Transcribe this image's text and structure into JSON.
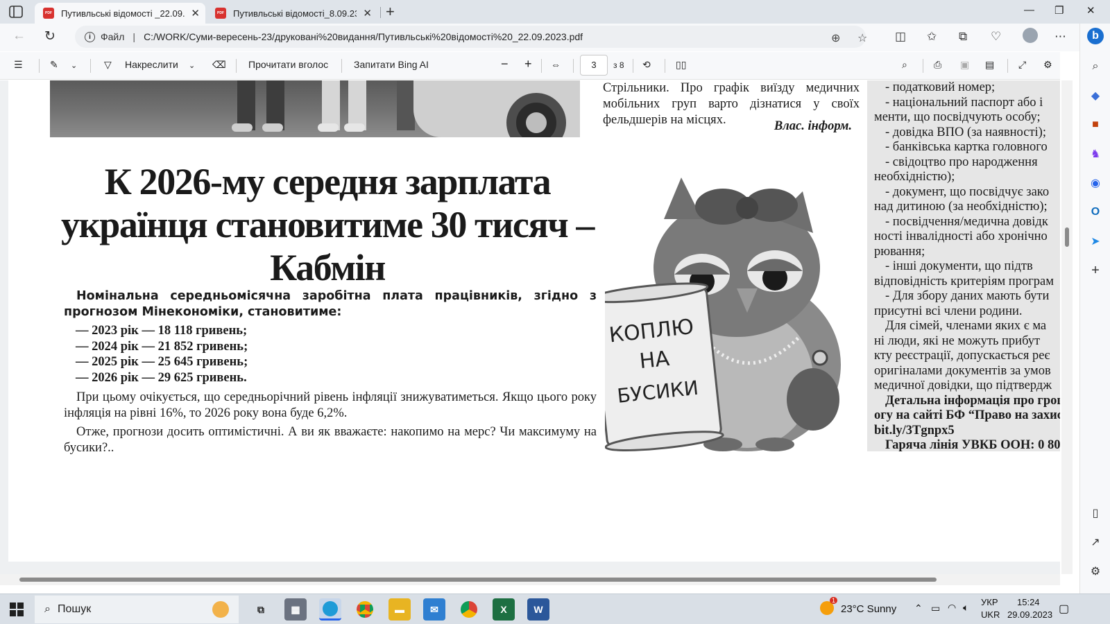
{
  "browser": {
    "tabs": [
      {
        "label": "Путивльські відомості _22.09.2023.pdf",
        "active": true
      },
      {
        "label": "Путивльські відомості_8.09.23.pdf",
        "active": false
      }
    ],
    "address": {
      "scheme_label": "Файл",
      "url": "C:/WORK/Суми-вересень-23/друковані%20видання/Путивльські%20відомості%20_22.09.2023.pdf"
    }
  },
  "pdf_toolbar": {
    "draw_label": "Накреслити",
    "read_aloud_label": "Прочитати вголос",
    "ask_bing_label": "Запитати Bing AI",
    "page_current": "3",
    "page_total": "з 8"
  },
  "article": {
    "headline": "К 2026-му середня зарплата українця становитиме 30 тисяч – Кабмін",
    "lead": "Номінальна середньомісячна заробітна плата працівників, згідно з прогнозом Мінекономіки, становитиме:",
    "forecast": [
      "2023 рік — 18 118 гривень;",
      "2024 рік — 21 852 гривень;",
      "2025 рік — 25 645 гривень;",
      "2026 рік — 29 625 гривень."
    ],
    "paragraph1": "При цьому очікується, що середньорічний рівень інфляції знижуватиметься. Якщо цього року інфляція на рівні 16%, то 2026 року вона буде 6,2%.",
    "paragraph2": "Отже, прогнози досить оптимістичні. А ви як вважаєте: накопимо на мерс? Чи максимуму на бусики?.."
  },
  "middle_column": {
    "top_fragment": "Стрільники. Про графік виїзду медичних мобільних груп варто дізнатися у своїх фельдшерів на місцях.",
    "byline": "Влас. інформ.",
    "owl_sign": [
      "КОПЛЮ",
      "НА",
      "БУСИКИ"
    ]
  },
  "right_column": {
    "lines": [
      {
        "text": "- податковий номер;",
        "ind": true,
        "bold": false
      },
      {
        "text": "- національний паспорт або і",
        "ind": true,
        "bold": false
      },
      {
        "text": "менти, що посвідчують особу;",
        "ind": false,
        "bold": false
      },
      {
        "text": "- довідка ВПО (за наявності);",
        "ind": true,
        "bold": false
      },
      {
        "text": "- банківська картка головного",
        "ind": true,
        "bold": false
      },
      {
        "text": "- свідоцтво про народження",
        "ind": true,
        "bold": false
      },
      {
        "text": "необхідністю);",
        "ind": false,
        "bold": false
      },
      {
        "text": "- документ, що посвідчує зако",
        "ind": true,
        "bold": false
      },
      {
        "text": "над дитиною (за необхідністю);",
        "ind": false,
        "bold": false
      },
      {
        "text": "- посвідчення/медична довідк",
        "ind": true,
        "bold": false
      },
      {
        "text": "ності інвалідності або хронічно",
        "ind": false,
        "bold": false
      },
      {
        "text": "рювання;",
        "ind": false,
        "bold": false
      },
      {
        "text": "- інші документи, що підтв",
        "ind": true,
        "bold": false
      },
      {
        "text": "відповідність критеріям програм",
        "ind": false,
        "bold": false
      },
      {
        "text": "- Для збору даних мають бути",
        "ind": true,
        "bold": false
      },
      {
        "text": "присутні всі члени родини.",
        "ind": false,
        "bold": false
      },
      {
        "text": "Для сімей, членами яких є ма",
        "ind": true,
        "bold": false
      },
      {
        "text": "ні люди, які не можуть прибут",
        "ind": false,
        "bold": false
      },
      {
        "text": "кту реєстрації, допускається реє",
        "ind": false,
        "bold": false
      },
      {
        "text": "оригіналами документів за умов",
        "ind": false,
        "bold": false
      },
      {
        "text": "медичної довідки, що підтвердж",
        "ind": false,
        "bold": false
      },
      {
        "text": "Детальна інформація про грошо",
        "ind": true,
        "bold": true
      },
      {
        "text": "огу на сайті БФ “Право на захис",
        "ind": false,
        "bold": true
      },
      {
        "text": "bit.ly/3Tgnpx5",
        "ind": false,
        "bold": true
      },
      {
        "text": "Гаряча лінія УВКБ ООН: 0 80",
        "ind": true,
        "bold": true
      }
    ]
  },
  "taskbar": {
    "search_placeholder": "Пошук",
    "weather": "23°C  Sunny",
    "weather_badge": "1",
    "lang_top": "УКР",
    "lang_bottom": "UKR",
    "time": "15:24",
    "date": "29.09.2023",
    "apps": [
      "task-view",
      "calculator",
      "edge",
      "chrome",
      "file-explorer",
      "mail",
      "chrome-profile",
      "excel",
      "word"
    ]
  },
  "colors": {
    "tabbar_bg": "#dfe4ea",
    "toolbar_bg": "#f7f8fa",
    "pdf_icon": "#d8322f",
    "taskbar_bg": "#d9dfe6",
    "excel": "#1d6f42",
    "word": "#2b579a"
  }
}
